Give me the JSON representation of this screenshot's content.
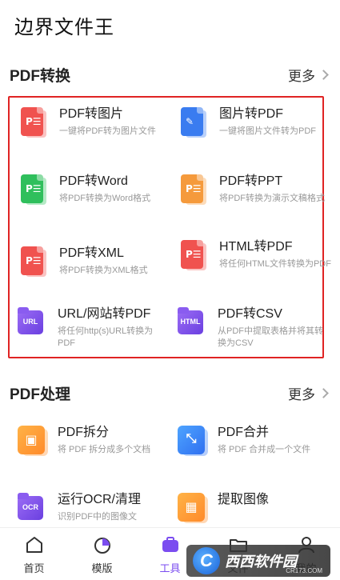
{
  "app": {
    "title": "边界文件王"
  },
  "section1": {
    "title": "PDF转换",
    "more": "更多",
    "tools": [
      {
        "name": "PDF转图片",
        "desc": "一键将PDF转为图片文件"
      },
      {
        "name": "图片转PDF",
        "desc": "一键将图片文件转为PDF"
      },
      {
        "name": "PDF转Word",
        "desc": "将PDF转换为Word格式"
      },
      {
        "name": "PDF转PPT",
        "desc": "将PDF转换为演示文稿格式"
      },
      {
        "name": "PDF转XML",
        "desc": "将PDF转换为XML格式"
      },
      {
        "name": "HTML转PDF",
        "desc": "将任何HTML文件转换为PDF"
      },
      {
        "name": "URL/网站转PDF",
        "desc": "将任何http(s)URL转换为PDF"
      },
      {
        "name": "PDF转CSV",
        "desc": "从PDF中提取表格并将其转换为CSV"
      }
    ]
  },
  "section2": {
    "title": "PDF处理",
    "more": "更多",
    "tools": [
      {
        "name": "PDF拆分",
        "desc": "将 PDF 拆分成多个文档"
      },
      {
        "name": "PDF合并",
        "desc": "将 PDF 合并成一个文件"
      },
      {
        "name": "运行OCR/清理",
        "desc": "识别PDF中的图像文"
      },
      {
        "name": "提取图像",
        "desc": ""
      }
    ]
  },
  "icons": {
    "pdf_mark": "P☰",
    "url_label": "URL",
    "html_label": "HTML",
    "ocr_label": "OCR"
  },
  "tabs": [
    {
      "label": "首页",
      "icon": "home-icon"
    },
    {
      "label": "模版",
      "icon": "template-icon"
    },
    {
      "label": "工具",
      "icon": "toolbox-icon"
    },
    {
      "label": "文件",
      "icon": "folder-icon"
    },
    {
      "label": "我的",
      "icon": "user-icon"
    }
  ],
  "watermark": {
    "text": "西西软件园",
    "sub": "CR173.COM"
  },
  "colors": {
    "accent": "#7b4df0",
    "highlight_box": "#e02424"
  }
}
